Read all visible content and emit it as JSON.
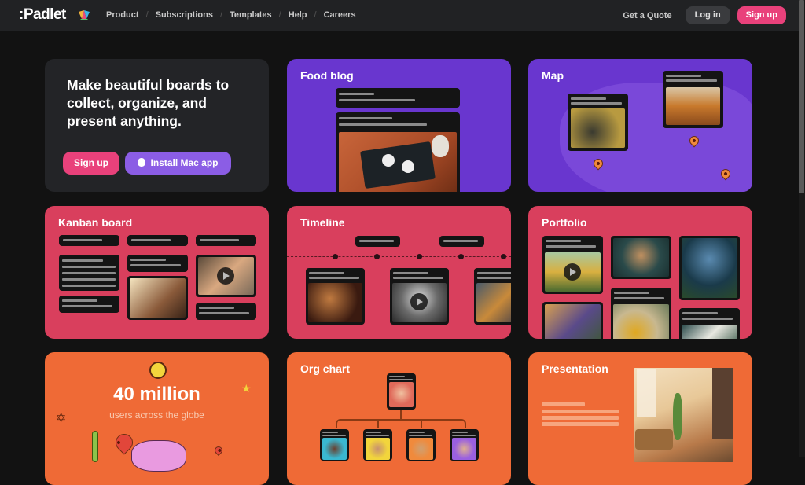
{
  "nav": {
    "logo": ":Padlet",
    "menu": [
      "Product",
      "Subscriptions",
      "Templates",
      "Help",
      "Careers"
    ],
    "separator": "/",
    "get_quote": "Get a Quote",
    "login": "Log in",
    "signup": "Sign up"
  },
  "hero": {
    "headline": "Make beautiful boards to collect, organize, and present anything.",
    "signup": "Sign up",
    "install": "Install Mac app",
    "install_icon": "apple-icon"
  },
  "cards": {
    "food_blog": "Food blog",
    "map": "Map",
    "kanban": "Kanban board",
    "timeline": "Timeline",
    "portfolio": "Portfolio",
    "stats_number": "40 million",
    "stats_label": "users across the globe",
    "org_chart": "Org chart",
    "presentation": "Presentation"
  },
  "colors": {
    "accent_pink": "#e9417b",
    "purple": "#6936cf",
    "red": "#d93f5d",
    "orange": "#ef6a36"
  }
}
